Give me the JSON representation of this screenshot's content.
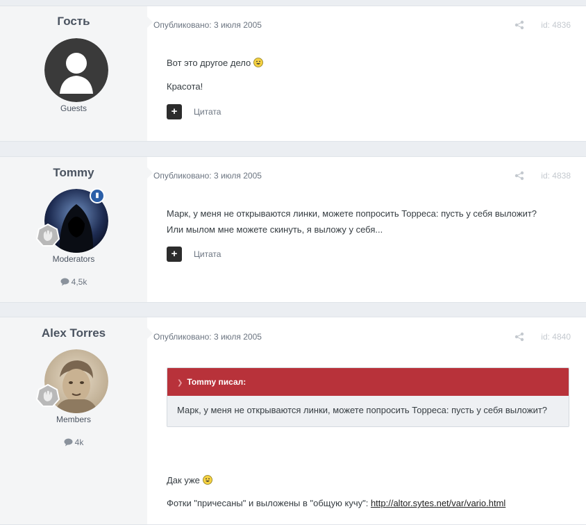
{
  "posts": [
    {
      "author": "Гость",
      "group": "Guests",
      "date": "Опубликовано: 3 июля 2005",
      "id": "id: 4836",
      "lines": [
        "Вот это другое дело",
        "Красота!"
      ],
      "quote_label": "Цитата"
    },
    {
      "author": "Tommy",
      "group": "Moderators",
      "count": "4,5k",
      "date": "Опубликовано: 3 июля 2005",
      "id": "id: 4838",
      "lines": [
        "Марк, у меня не открываются линки, можете попросить Торреса: пусть у себя выложит?",
        "Или мылом мне можете скинуть, я выложу у себя..."
      ],
      "quote_label": "Цитата"
    },
    {
      "author": "Alex Torres",
      "group": "Members",
      "count": "4k",
      "date": "Опубликовано: 3 июля 2005",
      "id": "id: 4840",
      "quote": {
        "header": "Tommy писал:",
        "text": "Марк, у меня не открываются линки, можете попросить Торреса: пусть у себя выложит?"
      },
      "line1": "Дак уже",
      "line2_prefix": "Фотки \"причесаны\" и выложены в \"общую кучу\": ",
      "link": "http://altor.sytes.net/var/vario.html"
    }
  ],
  "colors": {
    "quote_header": "#b8323a",
    "moderator_badge": "#2b5fa8",
    "sidebar": "#f4f5f6"
  }
}
